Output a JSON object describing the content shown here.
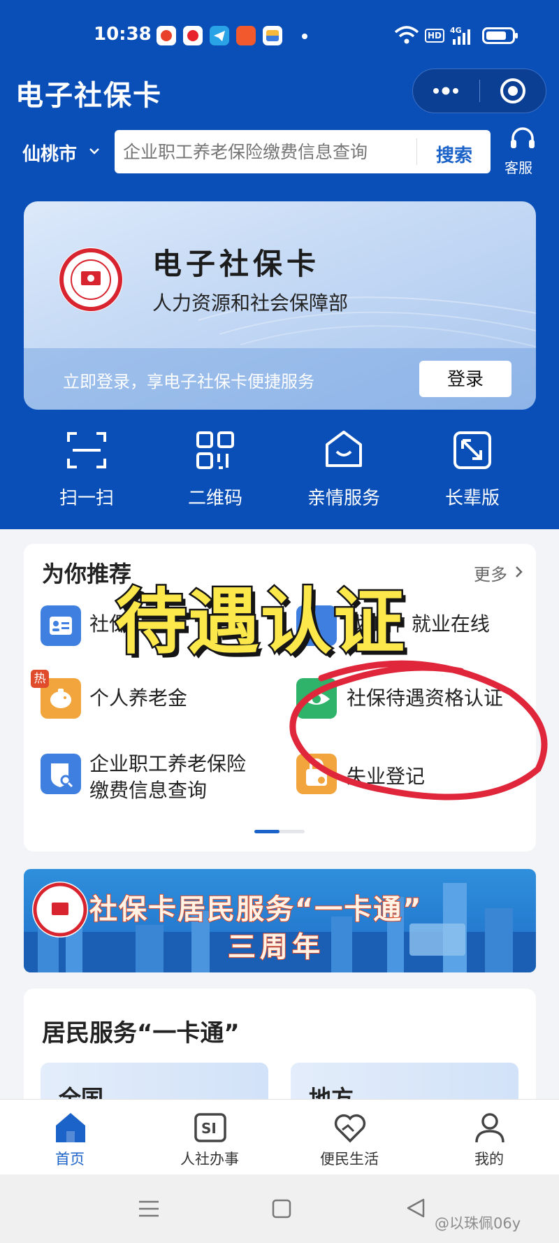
{
  "status_bar": {
    "time": "10:38"
  },
  "header": {
    "title": "电子社保卡"
  },
  "location": {
    "city": "仙桃市"
  },
  "search": {
    "placeholder": "企业职工养老保险缴费信息查询",
    "button_label": "搜索"
  },
  "customer_service": {
    "label": "客服"
  },
  "card": {
    "title": "电子社保卡",
    "subtitle": "人力资源和社会保障部",
    "strip_text": "立即登录，享电子社保卡便捷服务",
    "login_label": "登录"
  },
  "quick_actions": [
    {
      "label": "扫一扫",
      "icon": "scan-icon"
    },
    {
      "label": "二维码",
      "icon": "qrcode-icon"
    },
    {
      "label": "亲情服务",
      "icon": "family-house-icon"
    },
    {
      "label": "长辈版",
      "icon": "elder-mode-icon"
    }
  ],
  "recommend": {
    "title": "为你推荐",
    "more_label": "更多",
    "items": [
      {
        "label": "社保卡",
        "icon": "id-card-icon",
        "color": "#3f7fe0"
      },
      {
        "label": "找工作 就业在线",
        "icon": "briefcase-icon",
        "color": "#3f7fe0"
      },
      {
        "label": "个人养老金",
        "icon": "piggy-bank-icon",
        "color": "#f2a53c",
        "badge": "热"
      },
      {
        "label": "社保待遇资格认证",
        "icon": "eye-verify-icon",
        "color": "#2fb36a"
      },
      {
        "label": "企业职工养老保险缴费信息查询",
        "icon": "shield-search-icon",
        "color": "#3f7fe0"
      },
      {
        "label": "失业登记",
        "icon": "lock-bag-icon",
        "color": "#f2a53c"
      }
    ]
  },
  "overlay_text": "待遇认证",
  "banner": {
    "line1": "社保卡居民服务“一卡通”",
    "line2": "三周年"
  },
  "one_card": {
    "title": "居民服务“一卡通”",
    "tiles": [
      "全国",
      "地方"
    ]
  },
  "tabs": [
    {
      "label": "首页",
      "icon": "home-icon",
      "active": true
    },
    {
      "label": "人社办事",
      "icon": "si-icon",
      "active": false
    },
    {
      "label": "便民生活",
      "icon": "heart-hands-icon",
      "active": false
    },
    {
      "label": "我的",
      "icon": "person-icon",
      "active": false
    }
  ],
  "watermark": "@以珠佩06y",
  "colors": {
    "brand_blue": "#0a4fb8",
    "accent_blue": "#1b63c8",
    "highlight_red": "#e0263a",
    "overlay_yellow": "#fde84c"
  }
}
